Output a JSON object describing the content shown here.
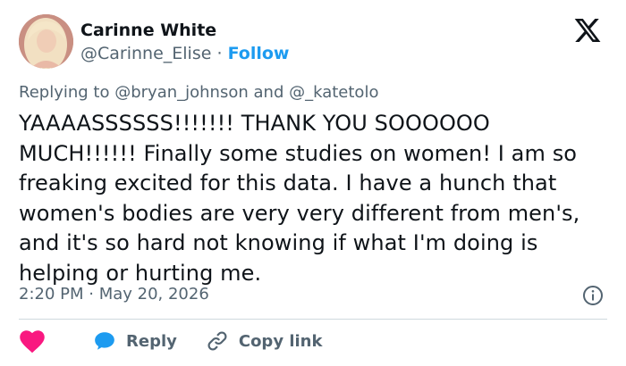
{
  "author": {
    "name": "Carinne White",
    "handle": "@Carinne_Elise",
    "separator": "·",
    "follow_label": "Follow",
    "avatar_icon": "profile-photo"
  },
  "brand_icon": "x-logo",
  "reply_context": {
    "prefix": "Replying to",
    "mention1": "@bryan_johnson",
    "conjunction": "and",
    "mention2": "@_katetolo"
  },
  "tweet": {
    "text": "YAAAASSSSSS!!!!!!! THANK YOU SOOOOOO MUCH!!!!!! Finally some studies on women! I am so freaking excited for this data. I have a hunch that women's bodies are very very different from men's, and it's so hard not knowing if what I'm doing is helping or hurting me.",
    "timestamp": "2:20 PM · May 20, 2026"
  },
  "actions": {
    "like_icon": "heart-icon",
    "reply_label": "Reply",
    "reply_icon": "speech-bubble-icon",
    "copy_label": "Copy link",
    "copy_icon": "link-icon",
    "info_icon": "info-icon"
  },
  "colors": {
    "accent": "#1d9bf0",
    "like": "#f91880",
    "secondary_text": "#536471",
    "primary_text": "#0f1419",
    "divider": "#cfd9de"
  }
}
